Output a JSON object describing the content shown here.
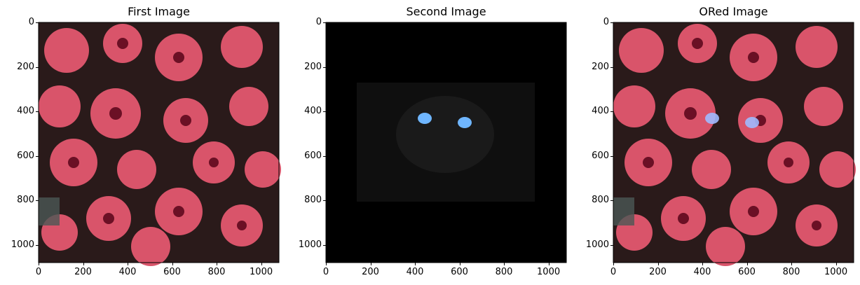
{
  "panels": [
    {
      "title": "First Image",
      "image": "photo: pink flowers (oxalis blossoms) on dark background",
      "x_ticks": [
        "0",
        "200",
        "400",
        "600",
        "800",
        "1000"
      ],
      "y_ticks": [
        "0",
        "200",
        "400",
        "600",
        "800",
        "1000"
      ]
    },
    {
      "title": "Second Image",
      "image": "photo: black cat face with glowing blue eyes on black background",
      "x_ticks": [
        "0",
        "200",
        "400",
        "600",
        "800",
        "1000"
      ],
      "y_ticks": [
        "0",
        "200",
        "400",
        "600",
        "800",
        "1000"
      ]
    },
    {
      "title": "ORed Image",
      "image": "photo: pink flowers combined (bitwise OR) with cat eyes",
      "x_ticks": [
        "0",
        "200",
        "400",
        "600",
        "800",
        "1000"
      ],
      "y_ticks": [
        "0",
        "200",
        "400",
        "600",
        "800",
        "1000"
      ]
    }
  ],
  "colors": {
    "flower_petal": "#d9546a",
    "flower_center": "#6b1025",
    "background_dark": "#2a1a1a",
    "cat_eye": "#6fb6ff",
    "black": "#000000"
  }
}
